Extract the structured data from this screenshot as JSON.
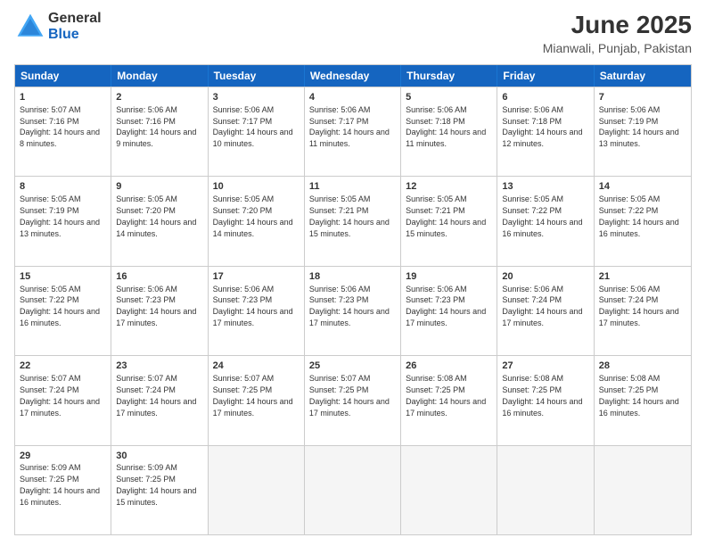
{
  "header": {
    "logo_general": "General",
    "logo_blue": "Blue",
    "main_title": "June 2025",
    "subtitle": "Mianwali, Punjab, Pakistan"
  },
  "calendar": {
    "days_of_week": [
      "Sunday",
      "Monday",
      "Tuesday",
      "Wednesday",
      "Thursday",
      "Friday",
      "Saturday"
    ],
    "weeks": [
      [
        {
          "day": "",
          "empty": true
        },
        {
          "day": "",
          "empty": true
        },
        {
          "day": "",
          "empty": true
        },
        {
          "day": "",
          "empty": true
        },
        {
          "day": "",
          "empty": true
        },
        {
          "day": "",
          "empty": true
        },
        {
          "day": "",
          "empty": true
        }
      ]
    ],
    "rows": [
      [
        {
          "num": "1",
          "sunrise": "5:07 AM",
          "sunset": "7:16 PM",
          "daylight": "14 hours and 8 minutes."
        },
        {
          "num": "2",
          "sunrise": "5:06 AM",
          "sunset": "7:16 PM",
          "daylight": "14 hours and 9 minutes."
        },
        {
          "num": "3",
          "sunrise": "5:06 AM",
          "sunset": "7:17 PM",
          "daylight": "14 hours and 10 minutes."
        },
        {
          "num": "4",
          "sunrise": "5:06 AM",
          "sunset": "7:17 PM",
          "daylight": "14 hours and 11 minutes."
        },
        {
          "num": "5",
          "sunrise": "5:06 AM",
          "sunset": "7:18 PM",
          "daylight": "14 hours and 11 minutes."
        },
        {
          "num": "6",
          "sunrise": "5:06 AM",
          "sunset": "7:18 PM",
          "daylight": "14 hours and 12 minutes."
        },
        {
          "num": "7",
          "sunrise": "5:06 AM",
          "sunset": "7:19 PM",
          "daylight": "14 hours and 13 minutes."
        }
      ],
      [
        {
          "num": "8",
          "sunrise": "5:05 AM",
          "sunset": "7:19 PM",
          "daylight": "14 hours and 13 minutes."
        },
        {
          "num": "9",
          "sunrise": "5:05 AM",
          "sunset": "7:20 PM",
          "daylight": "14 hours and 14 minutes."
        },
        {
          "num": "10",
          "sunrise": "5:05 AM",
          "sunset": "7:20 PM",
          "daylight": "14 hours and 14 minutes."
        },
        {
          "num": "11",
          "sunrise": "5:05 AM",
          "sunset": "7:21 PM",
          "daylight": "14 hours and 15 minutes."
        },
        {
          "num": "12",
          "sunrise": "5:05 AM",
          "sunset": "7:21 PM",
          "daylight": "14 hours and 15 minutes."
        },
        {
          "num": "13",
          "sunrise": "5:05 AM",
          "sunset": "7:22 PM",
          "daylight": "14 hours and 16 minutes."
        },
        {
          "num": "14",
          "sunrise": "5:05 AM",
          "sunset": "7:22 PM",
          "daylight": "14 hours and 16 minutes."
        }
      ],
      [
        {
          "num": "15",
          "sunrise": "5:05 AM",
          "sunset": "7:22 PM",
          "daylight": "14 hours and 16 minutes."
        },
        {
          "num": "16",
          "sunrise": "5:06 AM",
          "sunset": "7:23 PM",
          "daylight": "14 hours and 17 minutes."
        },
        {
          "num": "17",
          "sunrise": "5:06 AM",
          "sunset": "7:23 PM",
          "daylight": "14 hours and 17 minutes."
        },
        {
          "num": "18",
          "sunrise": "5:06 AM",
          "sunset": "7:23 PM",
          "daylight": "14 hours and 17 minutes."
        },
        {
          "num": "19",
          "sunrise": "5:06 AM",
          "sunset": "7:23 PM",
          "daylight": "14 hours and 17 minutes."
        },
        {
          "num": "20",
          "sunrise": "5:06 AM",
          "sunset": "7:24 PM",
          "daylight": "14 hours and 17 minutes."
        },
        {
          "num": "21",
          "sunrise": "5:06 AM",
          "sunset": "7:24 PM",
          "daylight": "14 hours and 17 minutes."
        }
      ],
      [
        {
          "num": "22",
          "sunrise": "5:07 AM",
          "sunset": "7:24 PM",
          "daylight": "14 hours and 17 minutes."
        },
        {
          "num": "23",
          "sunrise": "5:07 AM",
          "sunset": "7:24 PM",
          "daylight": "14 hours and 17 minutes."
        },
        {
          "num": "24",
          "sunrise": "5:07 AM",
          "sunset": "7:25 PM",
          "daylight": "14 hours and 17 minutes."
        },
        {
          "num": "25",
          "sunrise": "5:07 AM",
          "sunset": "7:25 PM",
          "daylight": "14 hours and 17 minutes."
        },
        {
          "num": "26",
          "sunrise": "5:08 AM",
          "sunset": "7:25 PM",
          "daylight": "14 hours and 17 minutes."
        },
        {
          "num": "27",
          "sunrise": "5:08 AM",
          "sunset": "7:25 PM",
          "daylight": "14 hours and 16 minutes."
        },
        {
          "num": "28",
          "sunrise": "5:08 AM",
          "sunset": "7:25 PM",
          "daylight": "14 hours and 16 minutes."
        }
      ],
      [
        {
          "num": "29",
          "sunrise": "5:09 AM",
          "sunset": "7:25 PM",
          "daylight": "14 hours and 16 minutes."
        },
        {
          "num": "30",
          "sunrise": "5:09 AM",
          "sunset": "7:25 PM",
          "daylight": "14 hours and 15 minutes."
        },
        {
          "num": "",
          "empty": true
        },
        {
          "num": "",
          "empty": true
        },
        {
          "num": "",
          "empty": true
        },
        {
          "num": "",
          "empty": true
        },
        {
          "num": "",
          "empty": true
        }
      ]
    ]
  }
}
